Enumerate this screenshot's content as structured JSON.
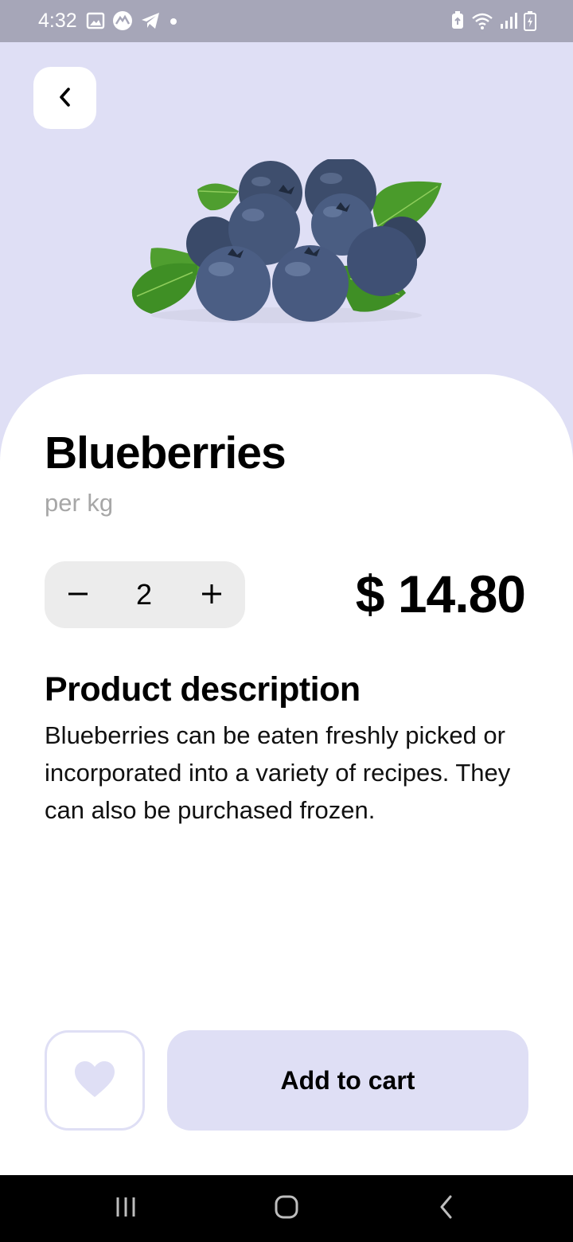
{
  "status_bar": {
    "time": "4:32",
    "left_icons": [
      "gallery-icon",
      "app-icon",
      "telegram-icon",
      "notification-dot-icon"
    ],
    "right_icons": [
      "battery-saver-icon",
      "wifi-icon",
      "signal-icon",
      "battery-charging-icon"
    ]
  },
  "header": {
    "back_icon": "chevron-left-icon"
  },
  "product": {
    "name": "Blueberries",
    "unit": "per kg",
    "quantity": "2",
    "price": "$ 14.80",
    "image": "blueberries-image"
  },
  "description": {
    "heading": "Product description",
    "body": "Blueberries can be eaten freshly picked or incorporated into a variety of recipes. They can also be purchased frozen."
  },
  "actions": {
    "favorite_icon": "heart-icon",
    "add_to_cart_label": "Add to cart"
  },
  "nav_bar": {
    "icons": [
      "recent-apps-icon",
      "home-icon",
      "back-icon"
    ]
  },
  "colors": {
    "accent": "#dfdff5",
    "status_bar": "#a6a6b8",
    "stepper_bg": "#ececec",
    "muted_text": "#a7a7a7"
  }
}
